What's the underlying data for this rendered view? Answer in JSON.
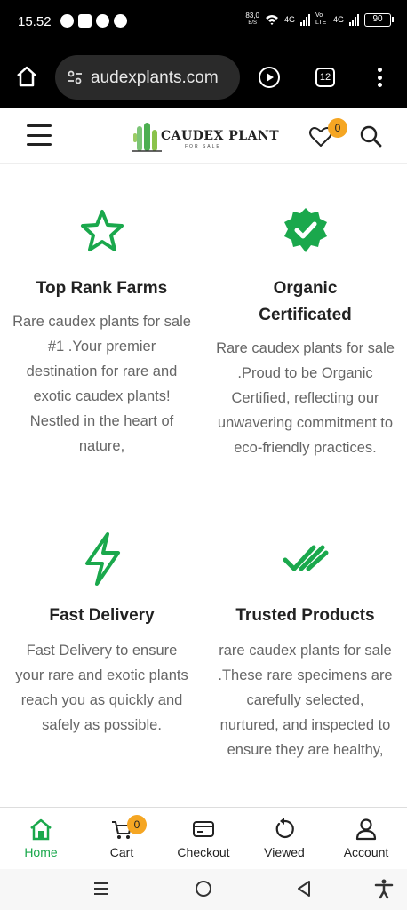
{
  "status_bar": {
    "time": "15.52",
    "net_speed": "83,0",
    "net_unit": "B/S",
    "sig1": "4G",
    "sig2": "4G",
    "volte": "Vo LTE",
    "battery": "90"
  },
  "browser": {
    "url": "audexplants.com",
    "tab_count": "12"
  },
  "header": {
    "logo_text": "CAUDEX PLANT",
    "logo_sub": "FOR SALE",
    "wishlist_count": "0"
  },
  "features": [
    {
      "icon": "star-outline-icon",
      "title": "Top Rank Farms",
      "description": "Rare caudex plants for sale #1 .Your premier destination for rare and exotic caudex plants! Nestled in the heart of nature,"
    },
    {
      "icon": "verified-badge-icon",
      "title": "Organic Certificated",
      "description": "Rare caudex plants for sale .Proud to be Organic Certified, reflecting our unwavering commitment to eco-friendly practices."
    },
    {
      "icon": "lightning-icon",
      "title": "Fast Delivery",
      "description": "Fast Delivery to ensure your rare and exotic plants reach you as quickly and safely as possible."
    },
    {
      "icon": "double-check-icon",
      "title": "Trusted Products",
      "description": "rare caudex plants for sale .These rare specimens are carefully selected, nurtured, and inspected to ensure they are healthy,"
    }
  ],
  "bottom_nav": {
    "home": "Home",
    "cart": "Cart",
    "cart_count": "0",
    "checkout": "Checkout",
    "viewed": "Viewed",
    "account": "Account"
  },
  "colors": {
    "accent": "#1aa84c",
    "badge": "#f5a623"
  }
}
